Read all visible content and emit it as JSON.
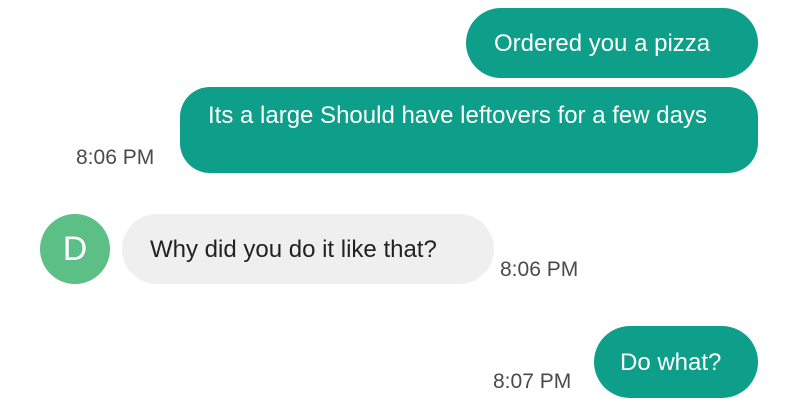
{
  "messages": [
    {
      "direction": "outgoing",
      "text": "Ordered you a pizza",
      "time": ""
    },
    {
      "direction": "outgoing",
      "text": "Its a large Should have leftovers for a few days",
      "time": "8:06 PM"
    },
    {
      "direction": "incoming",
      "sender_initial": "D",
      "text": "Why did you do it like that?",
      "time": "8:06 PM"
    },
    {
      "direction": "outgoing",
      "text": "Do what?",
      "time": "8:07 PM"
    }
  ],
  "colors": {
    "outgoing_bubble": "#0e9f8a",
    "incoming_bubble": "#efefef",
    "avatar": "#5cbf86"
  }
}
